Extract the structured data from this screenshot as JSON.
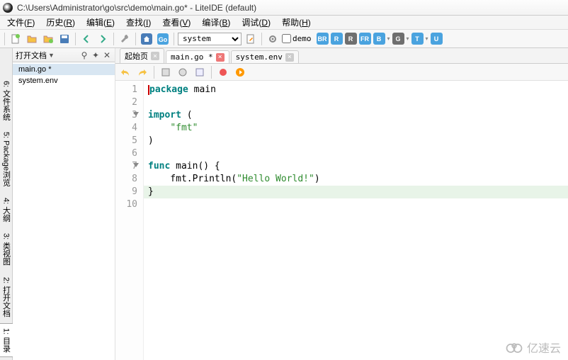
{
  "title": "C:\\Users\\Administrator\\go\\src\\demo\\main.go* - LiteIDE (default)",
  "menu": [
    {
      "label": "文件",
      "u": "F"
    },
    {
      "label": "历史",
      "u": "R"
    },
    {
      "label": "编辑",
      "u": "E"
    },
    {
      "label": "查找",
      "u": "I"
    },
    {
      "label": "查看",
      "u": "V"
    },
    {
      "label": "编译",
      "u": "B"
    },
    {
      "label": "调试",
      "u": "D"
    },
    {
      "label": "帮助",
      "u": "H"
    }
  ],
  "toolbar": {
    "env_combo": "system",
    "check_label": "demo"
  },
  "badges": [
    {
      "t": "BR",
      "c": "#4aa3df"
    },
    {
      "t": "R",
      "c": "#4aa3df"
    },
    {
      "t": "R",
      "c": "#6f6f6f"
    },
    {
      "t": "FR",
      "c": "#4aa3df"
    },
    {
      "t": "B",
      "c": "#4aa3df"
    },
    {
      "t": "G",
      "c": "#6f6f6f"
    },
    {
      "t": "T",
      "c": "#4aa3df"
    },
    {
      "t": "U",
      "c": "#4aa3df"
    }
  ],
  "left_tabs": [
    {
      "label": "1: 目录",
      "active": true
    },
    {
      "label": "2: 打开文档",
      "active": false
    },
    {
      "label": "3: 类视图",
      "active": false
    },
    {
      "label": "4: 大纲",
      "active": false
    },
    {
      "label": "5: Package浏览",
      "active": false
    },
    {
      "label": "6: 文件系统",
      "active": false
    }
  ],
  "side": {
    "title": "打开文档",
    "files": [
      {
        "name": "main.go *",
        "sel": true
      },
      {
        "name": "system.env",
        "sel": false
      }
    ]
  },
  "tabs": [
    {
      "label": "起始页",
      "close": true,
      "active": false
    },
    {
      "label": "main.go *",
      "close": true,
      "active": true
    },
    {
      "label": "system.env",
      "close": true,
      "active": false
    }
  ],
  "code": {
    "lines": [
      {
        "n": 1,
        "fold": false,
        "html": "<span class='cursor'></span><span class='kw'>package</span> main"
      },
      {
        "n": 2,
        "fold": false,
        "html": ""
      },
      {
        "n": 3,
        "fold": true,
        "html": "<span class='kw'>import</span> ("
      },
      {
        "n": 4,
        "fold": false,
        "html": "    <span class='str'>\"fmt\"</span>"
      },
      {
        "n": 5,
        "fold": false,
        "html": ")"
      },
      {
        "n": 6,
        "fold": false,
        "html": ""
      },
      {
        "n": 7,
        "fold": true,
        "html": "<span class='kw'>func</span> main() {"
      },
      {
        "n": 8,
        "fold": false,
        "html": "    fmt.Println(<span class='str'>\"Hello World!\"</span>)"
      },
      {
        "n": 9,
        "fold": false,
        "hl": true,
        "html": "}"
      },
      {
        "n": 10,
        "fold": false,
        "html": ""
      }
    ]
  },
  "watermark": "亿速云"
}
